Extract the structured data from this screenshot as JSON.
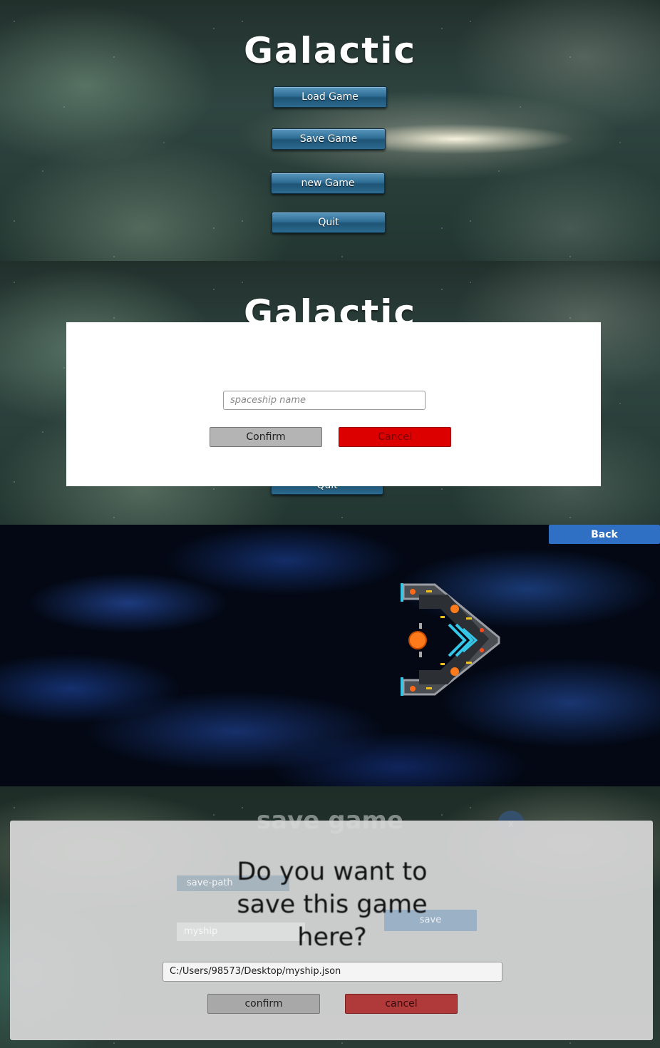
{
  "menu": {
    "title": "Galactic",
    "load_label": "Load Game",
    "save_label": "Save Game",
    "new_label": "new Game",
    "quit_label": "Quit"
  },
  "name_dialog": {
    "title": "Galactic",
    "input_placeholder": "spaceship name",
    "confirm_label": "Confirm",
    "cancel_label": "Cancel",
    "quit_partial": "Quit"
  },
  "space_view": {
    "back_label": "Back",
    "ship_icon": "spaceship-icon"
  },
  "save_dialog": {
    "title": "save game",
    "close_label": "x",
    "path_label": "save-path",
    "name_value": "myship",
    "save_label": "save",
    "question_line1": "Do you want to",
    "question_line2": "save this game",
    "question_line3": "here?",
    "path_value": "C:/Users/98573/Desktop/myship.json",
    "confirm_label": "confirm",
    "cancel_label": "cancel"
  },
  "colors": {
    "menu_button": "#2e6d94",
    "cancel_red": "#dd0000",
    "back_blue": "#2f6fc4",
    "confirm_gray": "#aaaaaa",
    "cancel_dark_red": "#b03a3a"
  }
}
